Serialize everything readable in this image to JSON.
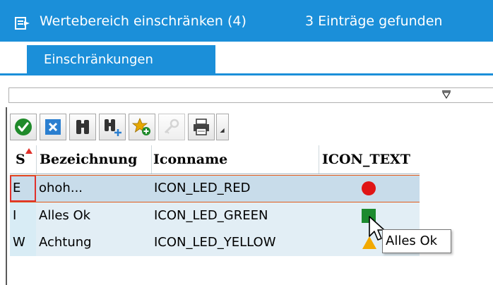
{
  "window": {
    "title": "Wertebereich einschränken (4)",
    "entries_found": "3 Einträge gefunden",
    "accent_color": "#1b8fd9"
  },
  "tabs": [
    {
      "label": "Einschränkungen",
      "active": true
    }
  ],
  "toolbar": {
    "buttons": [
      {
        "icon": "checkmark-icon",
        "enabled": true
      },
      {
        "icon": "cancel-icon",
        "enabled": true
      },
      {
        "icon": "binoculars-icon",
        "enabled": true
      },
      {
        "icon": "binoculars-plus-icon",
        "enabled": true
      },
      {
        "icon": "add-favorite-icon",
        "enabled": true
      },
      {
        "icon": "key-icon",
        "enabled": false
      },
      {
        "icon": "print-icon",
        "enabled": true
      }
    ]
  },
  "grid": {
    "columns": [
      "S",
      "Bezeichnung",
      "Iconname",
      "ICON_TEXT"
    ],
    "rows": [
      {
        "status": "E",
        "bezeichnung": "ohoh...",
        "iconname": "ICON_LED_RED",
        "icon": "red-led-icon",
        "selected": true
      },
      {
        "status": "I",
        "bezeichnung": "Alles Ok",
        "iconname": "ICON_LED_GREEN",
        "icon": "green-led-icon",
        "selected": false
      },
      {
        "status": "W",
        "bezeichnung": "Achtung",
        "iconname": "ICON_LED_YELLOW",
        "icon": "yellow-led-icon",
        "selected": false
      }
    ]
  },
  "tooltip": {
    "text": "Alles Ok"
  }
}
